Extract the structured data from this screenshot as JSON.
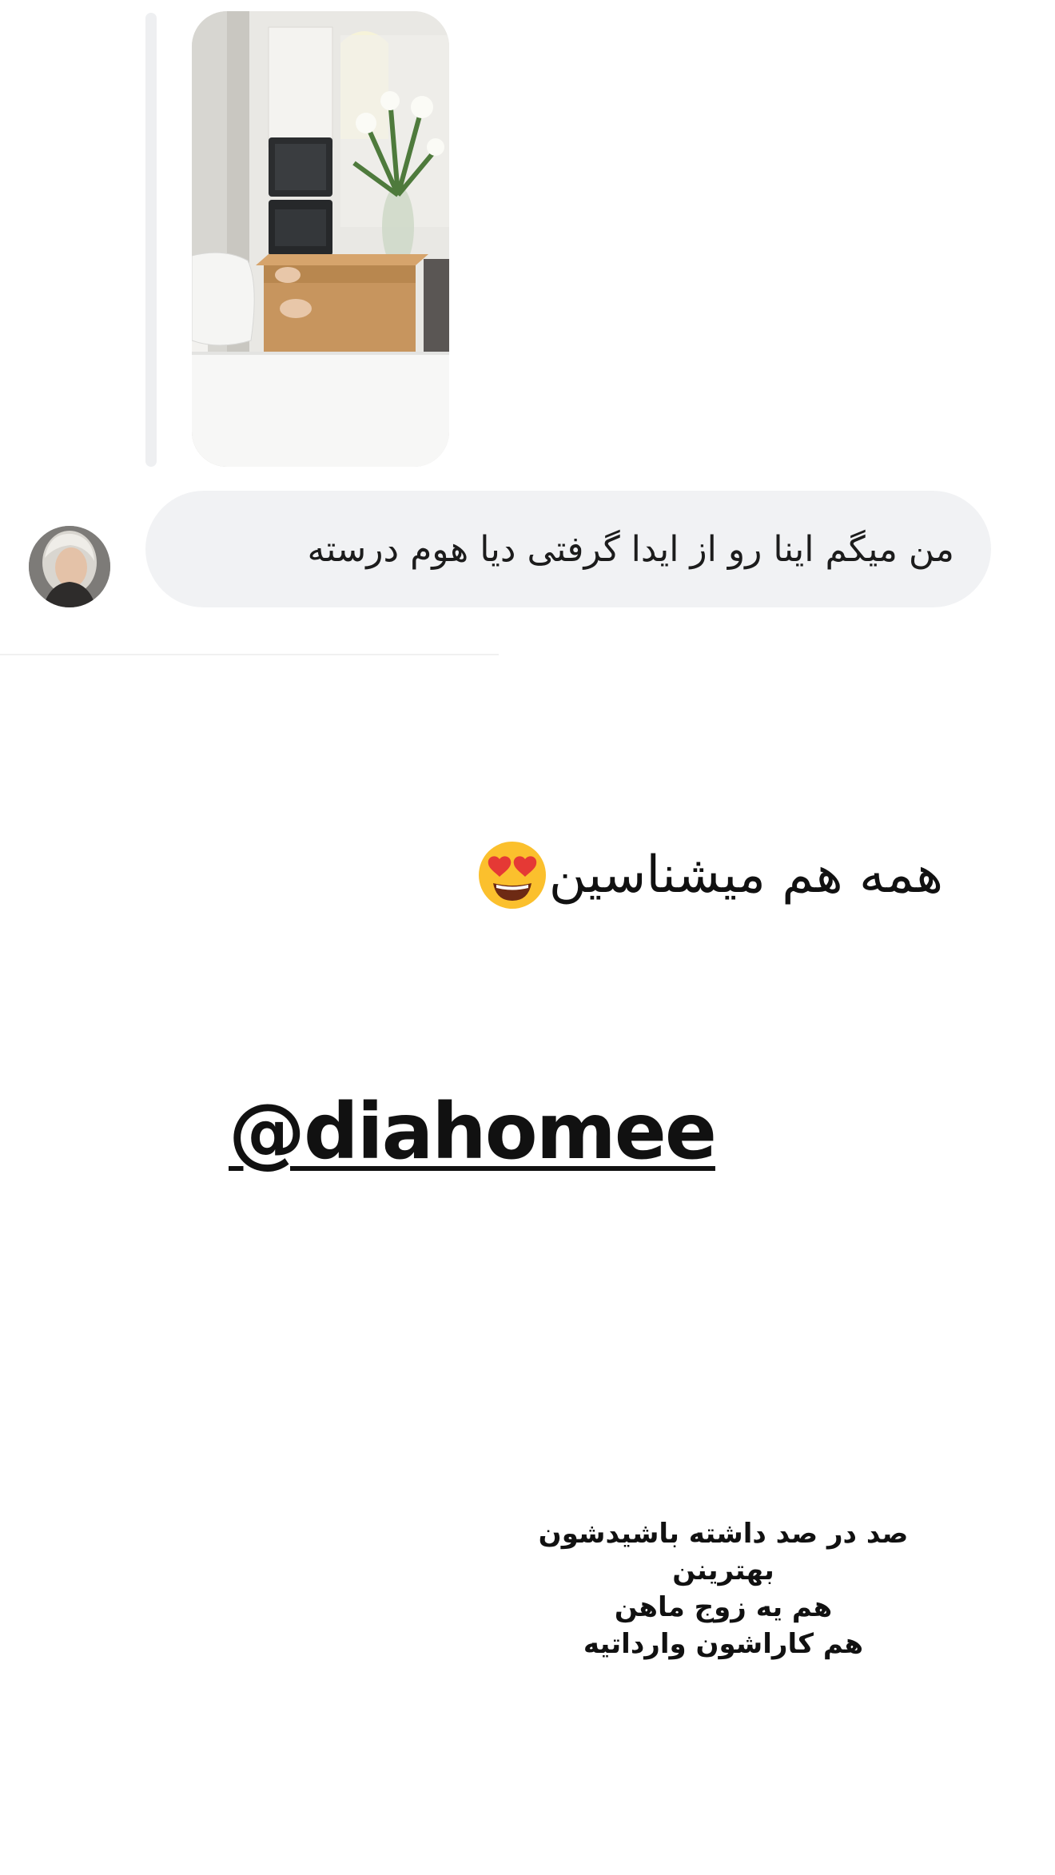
{
  "reply": {
    "message_text": "من میگم اینا رو از ایدا گرفتی دیا هوم درسته"
  },
  "story": {
    "caption": "همه هم میشناسین",
    "caption_emoji": "heart-eyes-emoji",
    "mention": "@diahomee",
    "lines": [
      "صد در صد داشته باشیدشون",
      "بهترینن",
      "هم یه زوج ماهن",
      "هم کاراشون وارداتیه"
    ]
  },
  "colors": {
    "bubble_bg": "#f1f2f4",
    "text": "#111111",
    "emoji_face": "#fbc02d",
    "emoji_heart": "#e53935"
  }
}
